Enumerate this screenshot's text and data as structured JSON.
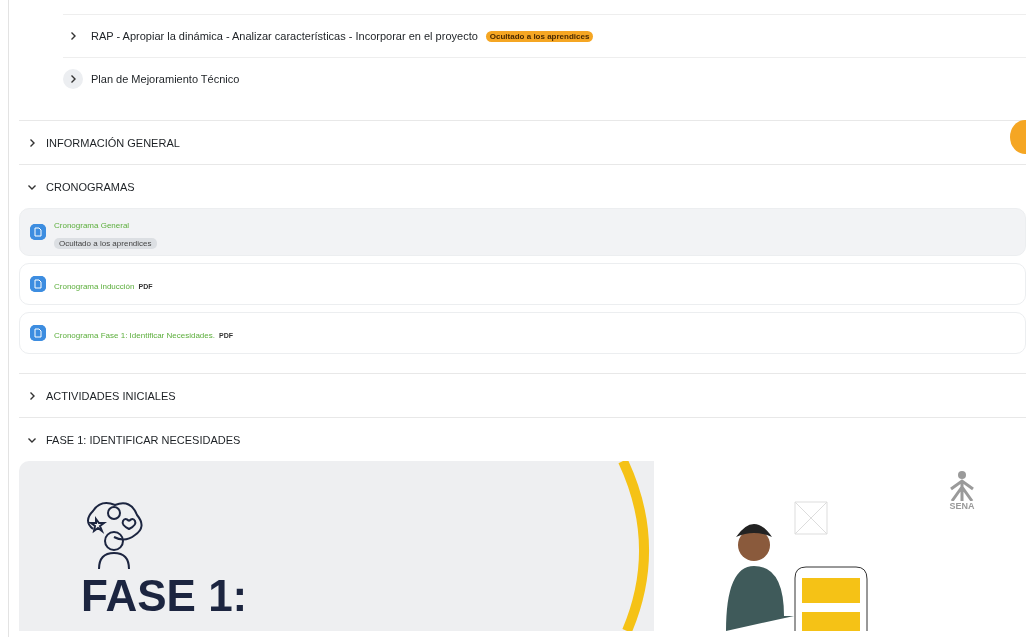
{
  "subsections": [
    {
      "label": "RAP - Apropiar la dinámica - Analizar características - Incorporar en el proyecto",
      "expanded": false,
      "badge": "Ocultado a los aprendices"
    },
    {
      "label": "Plan de Mejoramiento Técnico",
      "expanded": false
    }
  ],
  "sections": [
    {
      "title": "INFORMACIÓN GENERAL",
      "expanded": false
    },
    {
      "title": "CRONOGRAMAS",
      "expanded": true,
      "activities": [
        {
          "kind": "file",
          "name": "Cronograma General",
          "selected": true,
          "hidden_badge": "Ocultado a los aprendices"
        },
        {
          "kind": "file",
          "name": "Cronograma inducción",
          "selected": false,
          "file_type": "PDF"
        },
        {
          "kind": "file",
          "name": "Cronograma Fase 1: Identificar Necesidades.",
          "selected": false,
          "file_type": "PDF"
        }
      ]
    },
    {
      "title": "ACTIVIDADES INICIALES",
      "expanded": false
    },
    {
      "title": "FASE 1: IDENTIFICAR NECESIDADES",
      "expanded": true,
      "banner": {
        "heading": "FASE 1:",
        "logo_text": "SENA"
      }
    }
  ]
}
